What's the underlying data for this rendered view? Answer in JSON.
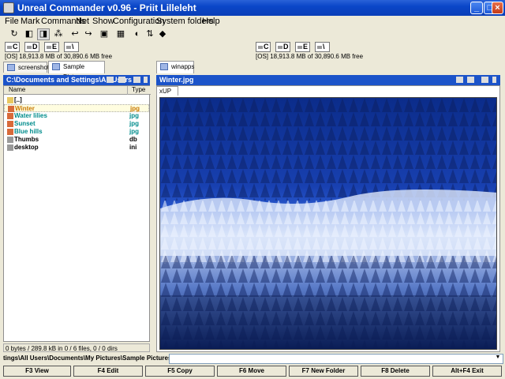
{
  "window": {
    "title": "Unreal Commander v0.96 - Priit Lilleleht"
  },
  "menu": [
    "File",
    "Mark",
    "Commands",
    "Net",
    "Show",
    "Configuration",
    "System folders",
    "Help"
  ],
  "toolbar_icons": [
    "refresh-icon",
    "brief-view-icon",
    "full-view-icon",
    "tree-icon",
    "back-icon",
    "forward-icon",
    "pack-icon",
    "find-icon",
    "compare-icon",
    "sync-icon",
    "ftp-icon"
  ],
  "left": {
    "drives": [
      "C",
      "D",
      "E",
      "\\"
    ],
    "free": "[OS]  18,913.8 MB of  30,890.6 MB free",
    "tabs": [
      "screenshots",
      "Sample Pictures"
    ],
    "active_tab": 1,
    "path": "C:\\Documents and Settings\\All Users",
    "columns": {
      "name": "Name",
      "type": "Type"
    },
    "files": [
      {
        "name": "[..]",
        "type": "",
        "color": "#000000",
        "icon": "up-folder-icon",
        "hilite": false
      },
      {
        "name": "Winter",
        "type": "jpg",
        "color": "#c87800",
        "icon": "image-file-icon",
        "hilite": true
      },
      {
        "name": "Water lilies",
        "type": "jpg",
        "color": "#008c8c",
        "icon": "image-file-icon",
        "hilite": false
      },
      {
        "name": "Sunset",
        "type": "jpg",
        "color": "#008c8c",
        "icon": "image-file-icon",
        "hilite": false
      },
      {
        "name": "Blue hills",
        "type": "jpg",
        "color": "#008c8c",
        "icon": "image-file-icon",
        "hilite": false
      },
      {
        "name": "Thumbs",
        "type": "db",
        "color": "#000000",
        "icon": "db-file-icon",
        "hilite": false
      },
      {
        "name": "desktop",
        "type": "ini",
        "color": "#000000",
        "icon": "ini-file-icon",
        "hilite": false
      }
    ],
    "status": "0 bytes / 289.8 kB in 0 / 6 files, 0 / 0 dirs"
  },
  "right": {
    "drives": [
      "C",
      "D",
      "E",
      "\\"
    ],
    "free": "[OS]  18,913.8 MB of  30,890.6 MB free",
    "tabs": [
      "winapps"
    ],
    "path": "Winter.jpg",
    "viewer_tab": "xUP"
  },
  "cmdline": {
    "prompt": "tings\\All Users\\Documents\\My Pictures\\Sample Pictures\\>",
    "value": ""
  },
  "fnkeys": [
    "F3 View",
    "F4 Edit",
    "F5 Copy",
    "F6 Move",
    "F7 New Folder",
    "F8 Delete",
    "Alt+F4 Exit"
  ],
  "colors": {
    "title_bar": "#0a46c8",
    "path_bar": "#1b53c9"
  }
}
